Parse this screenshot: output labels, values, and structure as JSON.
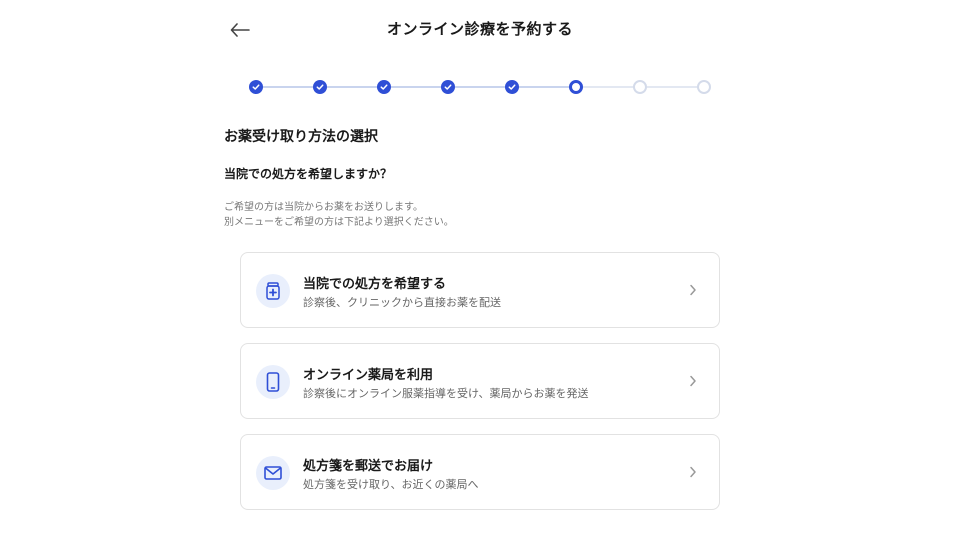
{
  "header": {
    "title": "オンライン診療を予約する"
  },
  "stepper": {
    "total_steps": 8,
    "completed_steps": 5,
    "current_step": 6,
    "colors": {
      "active": "#2f4fd6",
      "inactive": "#d4dbea"
    }
  },
  "section": {
    "title": "お薬受け取り方法の選択",
    "question": "当院での処方を希望しますか？",
    "description_line1": "ご希望の方は当院からお薬をお送りします。",
    "description_line2": "別メニューをご希望の方は下記より選択ください。"
  },
  "options": [
    {
      "icon": "medicine-bottle-icon",
      "title": "当院での処方を希望する",
      "subtitle": "診察後、クリニックから直接お薬を配送"
    },
    {
      "icon": "smartphone-icon",
      "title": "オンライン薬局を利用",
      "subtitle": "診察後にオンライン服薬指導を受け、薬局からお薬を発送"
    },
    {
      "icon": "envelope-icon",
      "title": "処方箋を郵送でお届け",
      "subtitle": "処方箋を受け取り、お近くの薬局へ"
    }
  ]
}
